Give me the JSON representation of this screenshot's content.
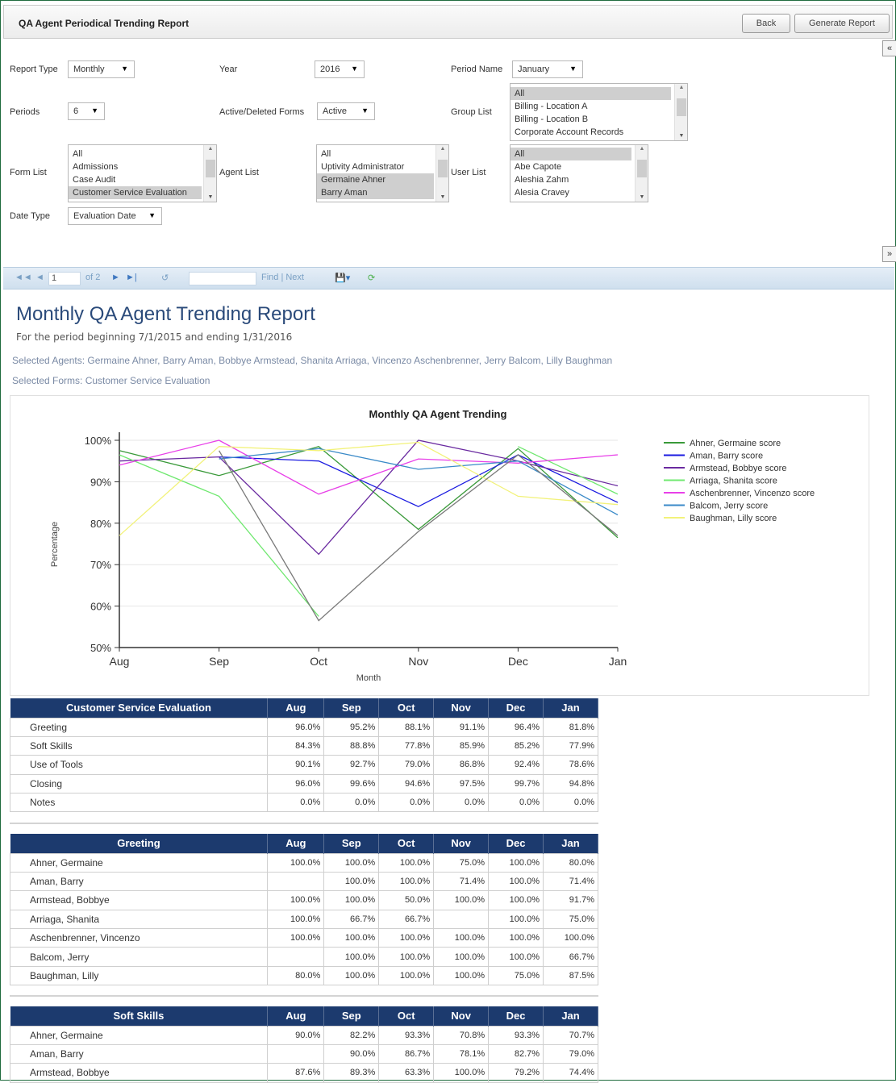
{
  "window": {
    "title": "QA Agent Periodical Trending Report",
    "back_label": "Back",
    "generate_label": "Generate Report"
  },
  "filters": {
    "report_type": {
      "label": "Report Type",
      "value": "Monthly"
    },
    "year": {
      "label": "Year",
      "value": "2016"
    },
    "period_name": {
      "label": "Period Name",
      "value": "January"
    },
    "periods": {
      "label": "Periods",
      "value": "6"
    },
    "active_deleted": {
      "label": "Active/Deleted Forms",
      "value": "Active"
    },
    "group_list": {
      "label": "Group List",
      "options": [
        "All",
        "Billing - Location A",
        "Billing - Location B",
        "Corporate Account Records"
      ]
    },
    "form_list": {
      "label": "Form List",
      "options": [
        "All",
        "Admissions",
        "Case Audit",
        "Customer Service Evaluation"
      ]
    },
    "agent_list": {
      "label": "Agent List",
      "options": [
        "All",
        "Uptivity Administrator",
        "Germaine Ahner",
        "Barry Aman"
      ]
    },
    "user_list": {
      "label": "User List",
      "options": [
        "All",
        "Abe Capote",
        "Aleshia Zahm",
        "Alesia Cravey"
      ]
    },
    "date_type": {
      "label": "Date Type",
      "value": "Evaluation Date"
    }
  },
  "toolbar": {
    "page_current": "1",
    "page_of": "of 2",
    "find_next": "Find | Next"
  },
  "report": {
    "title": "Monthly QA Agent Trending Report",
    "period_text": "For the period beginning 7/1/2015 and ending 1/31/2016",
    "agents_text": "Selected Agents: Germaine Ahner, Barry Aman, Bobbye Armstead, Shanita Arriaga, Vincenzo Aschenbrenner, Jerry Balcom, Lilly Baughman",
    "forms_text": "Selected Forms: Customer Service Evaluation"
  },
  "chart_data": {
    "type": "line",
    "title": "Monthly QA Agent Trending",
    "xlabel": "Month",
    "ylabel": "Percentage",
    "categories": [
      "Aug",
      "Sep",
      "Oct",
      "Nov",
      "Dec",
      "Jan"
    ],
    "yticks": [
      "50%",
      "60%",
      "70%",
      "80%",
      "90%",
      "100%"
    ],
    "ylim": [
      50,
      100
    ],
    "grid": true,
    "legend": "right",
    "series": [
      {
        "name": "Ahner, Germaine score",
        "color": "#3a9a3a",
        "values": [
          97.5,
          91.5,
          98.5,
          78.5,
          98,
          76.5
        ]
      },
      {
        "name": "Aman, Barry score",
        "color": "#1a1ae0",
        "values": [
          null,
          96,
          95,
          84,
          96.5,
          85
        ]
      },
      {
        "name": "Armstead, Bobbye score",
        "color": "#6a2aa0",
        "values": [
          95,
          96,
          72.5,
          100,
          95,
          89
        ]
      },
      {
        "name": "Arriaga, Shanita score",
        "color": "#70e870",
        "values": [
          96.5,
          86.5,
          57.5,
          null,
          98.5,
          87
        ]
      },
      {
        "name": "Aschenbrenner, Vincenzo score",
        "color": "#e840e8",
        "values": [
          94,
          100,
          87,
          95.5,
          94.5,
          96.5
        ]
      },
      {
        "name": "Balcom, Jerry score",
        "color": "#3a8ac8",
        "values": [
          null,
          95.5,
          98,
          93,
          95,
          82
        ]
      },
      {
        "name": "Baughman, Lilly score",
        "color": "#f2f27a",
        "values": [
          77,
          98.5,
          97.5,
          99.5,
          86.5,
          84.5
        ]
      },
      {
        "name": "",
        "color": "#7a7a7a",
        "values": [
          null,
          97.5,
          56.5,
          78,
          96.5,
          77
        ]
      }
    ]
  },
  "tables": [
    {
      "header": "Customer Service Evaluation",
      "months": [
        "Aug",
        "Sep",
        "Oct",
        "Nov",
        "Dec",
        "Jan"
      ],
      "rows": [
        {
          "name": "Greeting",
          "values": [
            "96.0%",
            "95.2%",
            "88.1%",
            "91.1%",
            "96.4%",
            "81.8%"
          ]
        },
        {
          "name": "Soft Skills",
          "values": [
            "84.3%",
            "88.8%",
            "77.8%",
            "85.9%",
            "85.2%",
            "77.9%"
          ]
        },
        {
          "name": "Use of Tools",
          "values": [
            "90.1%",
            "92.7%",
            "79.0%",
            "86.8%",
            "92.4%",
            "78.6%"
          ]
        },
        {
          "name": "Closing",
          "values": [
            "96.0%",
            "99.6%",
            "94.6%",
            "97.5%",
            "99.7%",
            "94.8%"
          ]
        },
        {
          "name": "Notes",
          "values": [
            "0.0%",
            "0.0%",
            "0.0%",
            "0.0%",
            "0.0%",
            "0.0%"
          ]
        }
      ]
    },
    {
      "header": "Greeting",
      "months": [
        "Aug",
        "Sep",
        "Oct",
        "Nov",
        "Dec",
        "Jan"
      ],
      "rows": [
        {
          "name": "Ahner, Germaine",
          "values": [
            "100.0%",
            "100.0%",
            "100.0%",
            "75.0%",
            "100.0%",
            "80.0%"
          ]
        },
        {
          "name": "Aman, Barry",
          "values": [
            "",
            "100.0%",
            "100.0%",
            "71.4%",
            "100.0%",
            "71.4%"
          ]
        },
        {
          "name": "Armstead, Bobbye",
          "values": [
            "100.0%",
            "100.0%",
            "50.0%",
            "100.0%",
            "100.0%",
            "91.7%"
          ]
        },
        {
          "name": "Arriaga, Shanita",
          "values": [
            "100.0%",
            "66.7%",
            "66.7%",
            "",
            "100.0%",
            "75.0%"
          ]
        },
        {
          "name": "Aschenbrenner, Vincenzo",
          "values": [
            "100.0%",
            "100.0%",
            "100.0%",
            "100.0%",
            "100.0%",
            "100.0%"
          ]
        },
        {
          "name": "Balcom, Jerry",
          "values": [
            "",
            "100.0%",
            "100.0%",
            "100.0%",
            "100.0%",
            "66.7%"
          ]
        },
        {
          "name": "Baughman, Lilly",
          "values": [
            "80.0%",
            "100.0%",
            "100.0%",
            "100.0%",
            "75.0%",
            "87.5%"
          ]
        }
      ]
    },
    {
      "header": "Soft Skills",
      "months": [
        "Aug",
        "Sep",
        "Oct",
        "Nov",
        "Dec",
        "Jan"
      ],
      "rows": [
        {
          "name": "Ahner, Germaine",
          "values": [
            "90.0%",
            "82.2%",
            "93.3%",
            "70.8%",
            "93.3%",
            "70.7%"
          ]
        },
        {
          "name": "Aman, Barry",
          "values": [
            "",
            "90.0%",
            "86.7%",
            "78.1%",
            "82.7%",
            "79.0%"
          ]
        },
        {
          "name": "Armstead, Bobbye",
          "values": [
            "87.6%",
            "89.3%",
            "63.3%",
            "100.0%",
            "79.2%",
            "74.4%"
          ]
        }
      ]
    }
  ]
}
